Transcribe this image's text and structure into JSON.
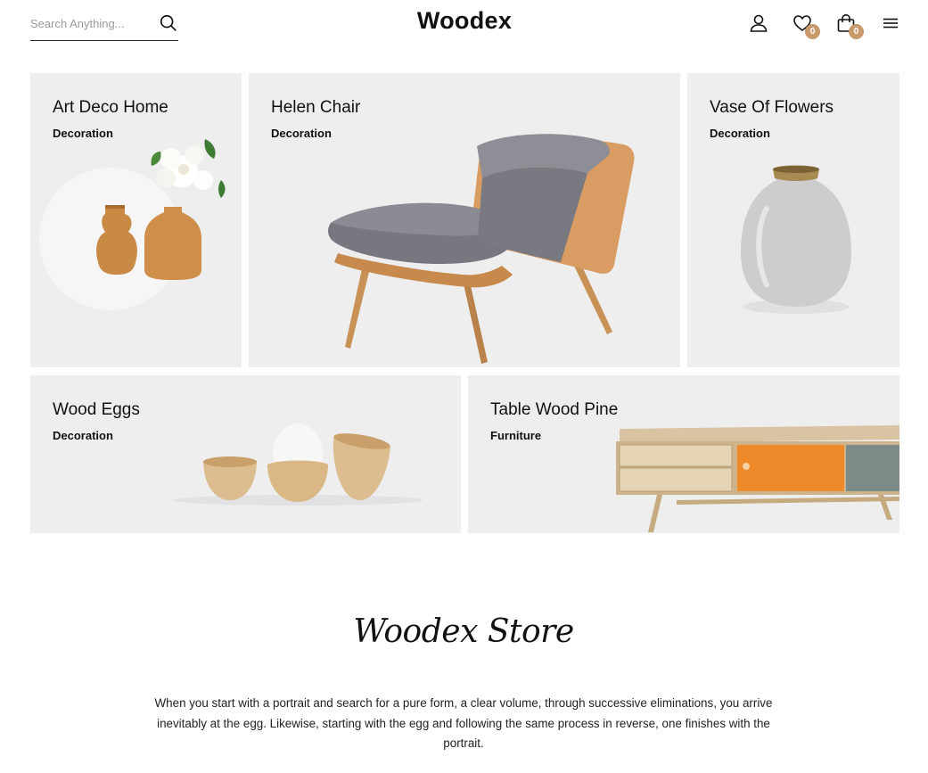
{
  "search": {
    "placeholder": "Search Anything..."
  },
  "header": {
    "logo": "Woodex",
    "wishlist_count": "0",
    "cart_count": "0"
  },
  "cards": [
    {
      "title": "Art Deco Home",
      "category": "Decoration"
    },
    {
      "title": "Helen Chair",
      "category": "Decoration"
    },
    {
      "title": "Vase Of Flowers",
      "category": "Decoration"
    },
    {
      "title": "Wood Eggs",
      "category": "Decoration"
    },
    {
      "title": "Table Wood Pine",
      "category": "Furniture"
    }
  ],
  "store": {
    "title": "Woodex Store",
    "description": "When you start with a portrait and search for a pure form, a clear volume, through successive eliminations, you arrive inevitably at the egg. Likewise, starting with the egg and following the same process in reverse, one finishes with the portrait."
  },
  "colors": {
    "accent": "#c89a6b",
    "card_bg": "#eeeeef",
    "text": "#111111"
  },
  "icons": [
    "search-icon",
    "user-icon",
    "heart-icon",
    "bag-icon",
    "menu-icon"
  ]
}
